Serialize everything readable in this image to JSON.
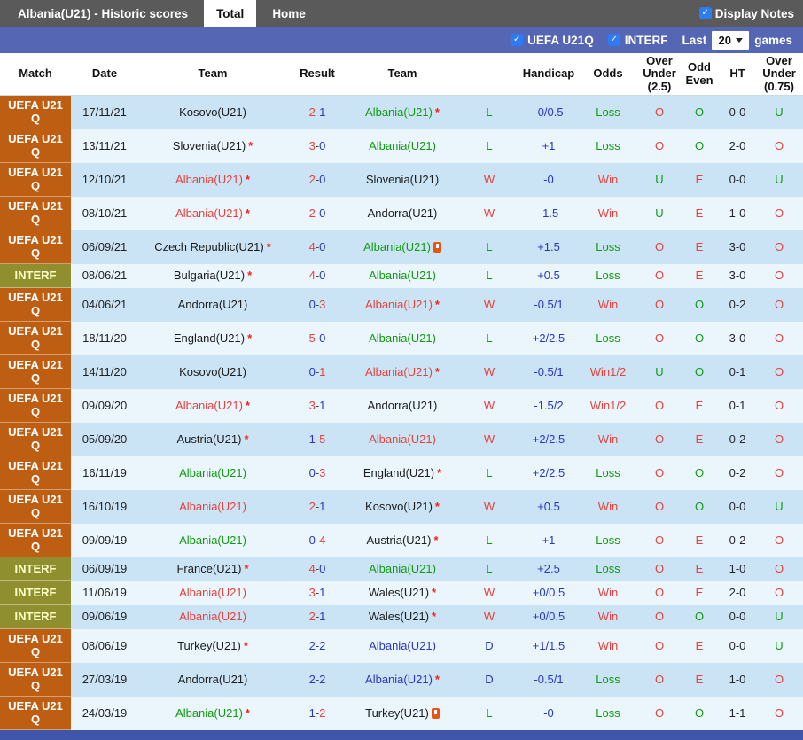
{
  "topbar": {
    "title": "Albania(U21) - Historic scores",
    "tabs": [
      {
        "label": "Total",
        "active": true
      },
      {
        "label": "Home",
        "active": false
      }
    ],
    "display_notes_label": "Display Notes",
    "display_notes_checked": true
  },
  "filterbar": {
    "checkboxes": [
      {
        "label": "UEFA U21Q",
        "checked": true
      },
      {
        "label": "INTERF",
        "checked": true
      }
    ],
    "last_label": "Last",
    "games_count": "20",
    "games_label": "games"
  },
  "colors": {
    "red": "#e8413d",
    "green": "#0f9b0f",
    "blue": "#2a36c4",
    "black": "#1c1c1c",
    "uefa_bg": "#bd5e13",
    "interf_bg": "#8f8f2f",
    "interf_text": "#ffffc8",
    "row_blue": "#cbe4f5",
    "row_light": "#eaf5fc",
    "topbar_bg": "#5a5a5a",
    "filterbar_bg": "#5466b4",
    "footer_bg": "#4056aa",
    "checkbox_blue": "#2e7bf6",
    "card_orange": "#e85512"
  },
  "table": {
    "headers": {
      "match": "Match",
      "date": "Date",
      "team1": "Team",
      "result": "Result",
      "team2": "Team",
      "hcp_result": "",
      "handicap": "Handicap",
      "odds": "Odds",
      "ou25": "Over Under (2.5)",
      "oddeven": "Odd Even",
      "ht": "HT",
      "ou075": "Over Under (0.75)"
    },
    "rows": [
      {
        "league": "UEFA U21 Q",
        "ltype": "uefa",
        "date": "17/11/21",
        "t1": "Kosovo(U21)",
        "t1c": "black",
        "t1s": false,
        "t1card": false,
        "s1": "2",
        "s1c": "red",
        "s2": "1",
        "s2c": "blue",
        "t2": "Albania(U21)",
        "t2c": "green",
        "t2s": true,
        "t2card": false,
        "hr": "L",
        "hrc": "green",
        "hcp": "-0/0.5",
        "odds": "Loss",
        "oddsc": "green",
        "ou": "O",
        "ouc": "red",
        "oe": "O",
        "oec": "green",
        "ht": "0-0",
        "ou2": "U",
        "ou2c": "green"
      },
      {
        "league": "UEFA U21 Q",
        "ltype": "uefa",
        "date": "13/11/21",
        "t1": "Slovenia(U21)",
        "t1c": "black",
        "t1s": true,
        "t1card": false,
        "s1": "3",
        "s1c": "red",
        "s2": "0",
        "s2c": "blue",
        "t2": "Albania(U21)",
        "t2c": "green",
        "t2s": false,
        "t2card": false,
        "hr": "L",
        "hrc": "green",
        "hcp": "+1",
        "odds": "Loss",
        "oddsc": "green",
        "ou": "O",
        "ouc": "red",
        "oe": "O",
        "oec": "green",
        "ht": "2-0",
        "ou2": "O",
        "ou2c": "red"
      },
      {
        "league": "UEFA U21 Q",
        "ltype": "uefa",
        "date": "12/10/21",
        "t1": "Albania(U21)",
        "t1c": "red",
        "t1s": true,
        "t1card": false,
        "s1": "2",
        "s1c": "red",
        "s2": "0",
        "s2c": "blue",
        "t2": "Slovenia(U21)",
        "t2c": "black",
        "t2s": false,
        "t2card": false,
        "hr": "W",
        "hrc": "red",
        "hcp": "-0",
        "odds": "Win",
        "oddsc": "red",
        "ou": "U",
        "ouc": "green",
        "oe": "E",
        "oec": "red",
        "ht": "0-0",
        "ou2": "U",
        "ou2c": "green"
      },
      {
        "league": "UEFA U21 Q",
        "ltype": "uefa",
        "date": "08/10/21",
        "t1": "Albania(U21)",
        "t1c": "red",
        "t1s": true,
        "t1card": false,
        "s1": "2",
        "s1c": "red",
        "s2": "0",
        "s2c": "blue",
        "t2": "Andorra(U21)",
        "t2c": "black",
        "t2s": false,
        "t2card": false,
        "hr": "W",
        "hrc": "red",
        "hcp": "-1.5",
        "odds": "Win",
        "oddsc": "red",
        "ou": "U",
        "ouc": "green",
        "oe": "E",
        "oec": "red",
        "ht": "1-0",
        "ou2": "O",
        "ou2c": "red"
      },
      {
        "league": "UEFA U21 Q",
        "ltype": "uefa",
        "date": "06/09/21",
        "t1": "Czech Republic(U21)",
        "t1c": "black",
        "t1s": true,
        "t1card": false,
        "s1": "4",
        "s1c": "red",
        "s2": "0",
        "s2c": "blue",
        "t2": "Albania(U21)",
        "t2c": "green",
        "t2s": false,
        "t2card": true,
        "hr": "L",
        "hrc": "green",
        "hcp": "+1.5",
        "odds": "Loss",
        "oddsc": "green",
        "ou": "O",
        "ouc": "red",
        "oe": "E",
        "oec": "red",
        "ht": "3-0",
        "ou2": "O",
        "ou2c": "red"
      },
      {
        "league": "INTERF",
        "ltype": "interf",
        "date": "08/06/21",
        "t1": "Bulgaria(U21)",
        "t1c": "black",
        "t1s": true,
        "t1card": false,
        "s1": "4",
        "s1c": "red",
        "s2": "0",
        "s2c": "blue",
        "t2": "Albania(U21)",
        "t2c": "green",
        "t2s": false,
        "t2card": false,
        "hr": "L",
        "hrc": "green",
        "hcp": "+0.5",
        "odds": "Loss",
        "oddsc": "green",
        "ou": "O",
        "ouc": "red",
        "oe": "E",
        "oec": "red",
        "ht": "3-0",
        "ou2": "O",
        "ou2c": "red"
      },
      {
        "league": "UEFA U21 Q",
        "ltype": "uefa",
        "date": "04/06/21",
        "t1": "Andorra(U21)",
        "t1c": "black",
        "t1s": false,
        "t1card": false,
        "s1": "0",
        "s1c": "blue",
        "s2": "3",
        "s2c": "red",
        "t2": "Albania(U21)",
        "t2c": "red",
        "t2s": true,
        "t2card": false,
        "hr": "W",
        "hrc": "red",
        "hcp": "-0.5/1",
        "odds": "Win",
        "oddsc": "red",
        "ou": "O",
        "ouc": "red",
        "oe": "O",
        "oec": "green",
        "ht": "0-2",
        "ou2": "O",
        "ou2c": "red"
      },
      {
        "league": "UEFA U21 Q",
        "ltype": "uefa",
        "date": "18/11/20",
        "t1": "England(U21)",
        "t1c": "black",
        "t1s": true,
        "t1card": false,
        "s1": "5",
        "s1c": "red",
        "s2": "0",
        "s2c": "blue",
        "t2": "Albania(U21)",
        "t2c": "green",
        "t2s": false,
        "t2card": false,
        "hr": "L",
        "hrc": "green",
        "hcp": "+2/2.5",
        "odds": "Loss",
        "oddsc": "green",
        "ou": "O",
        "ouc": "red",
        "oe": "O",
        "oec": "green",
        "ht": "3-0",
        "ou2": "O",
        "ou2c": "red"
      },
      {
        "league": "UEFA U21 Q",
        "ltype": "uefa",
        "date": "14/11/20",
        "t1": "Kosovo(U21)",
        "t1c": "black",
        "t1s": false,
        "t1card": false,
        "s1": "0",
        "s1c": "blue",
        "s2": "1",
        "s2c": "red",
        "t2": "Albania(U21)",
        "t2c": "red",
        "t2s": true,
        "t2card": false,
        "hr": "W",
        "hrc": "red",
        "hcp": "-0.5/1",
        "odds": "Win1/2",
        "oddsc": "red",
        "ou": "U",
        "ouc": "green",
        "oe": "O",
        "oec": "green",
        "ht": "0-1",
        "ou2": "O",
        "ou2c": "red"
      },
      {
        "league": "UEFA U21 Q",
        "ltype": "uefa",
        "date": "09/09/20",
        "t1": "Albania(U21)",
        "t1c": "red",
        "t1s": true,
        "t1card": false,
        "s1": "3",
        "s1c": "red",
        "s2": "1",
        "s2c": "blue",
        "t2": "Andorra(U21)",
        "t2c": "black",
        "t2s": false,
        "t2card": false,
        "hr": "W",
        "hrc": "red",
        "hcp": "-1.5/2",
        "odds": "Win1/2",
        "oddsc": "red",
        "ou": "O",
        "ouc": "red",
        "oe": "E",
        "oec": "red",
        "ht": "0-1",
        "ou2": "O",
        "ou2c": "red"
      },
      {
        "league": "UEFA U21 Q",
        "ltype": "uefa",
        "date": "05/09/20",
        "t1": "Austria(U21)",
        "t1c": "black",
        "t1s": true,
        "t1card": false,
        "s1": "1",
        "s1c": "blue",
        "s2": "5",
        "s2c": "red",
        "t2": "Albania(U21)",
        "t2c": "red",
        "t2s": false,
        "t2card": false,
        "hr": "W",
        "hrc": "red",
        "hcp": "+2/2.5",
        "odds": "Win",
        "oddsc": "red",
        "ou": "O",
        "ouc": "red",
        "oe": "E",
        "oec": "red",
        "ht": "0-2",
        "ou2": "O",
        "ou2c": "red"
      },
      {
        "league": "UEFA U21 Q",
        "ltype": "uefa",
        "date": "16/11/19",
        "t1": "Albania(U21)",
        "t1c": "green",
        "t1s": false,
        "t1card": false,
        "s1": "0",
        "s1c": "blue",
        "s2": "3",
        "s2c": "red",
        "t2": "England(U21)",
        "t2c": "black",
        "t2s": true,
        "t2card": false,
        "hr": "L",
        "hrc": "green",
        "hcp": "+2/2.5",
        "odds": "Loss",
        "oddsc": "green",
        "ou": "O",
        "ouc": "red",
        "oe": "O",
        "oec": "green",
        "ht": "0-2",
        "ou2": "O",
        "ou2c": "red"
      },
      {
        "league": "UEFA U21 Q",
        "ltype": "uefa",
        "date": "16/10/19",
        "t1": "Albania(U21)",
        "t1c": "red",
        "t1s": false,
        "t1card": false,
        "s1": "2",
        "s1c": "red",
        "s2": "1",
        "s2c": "blue",
        "t2": "Kosovo(U21)",
        "t2c": "black",
        "t2s": true,
        "t2card": false,
        "hr": "W",
        "hrc": "red",
        "hcp": "+0.5",
        "odds": "Win",
        "oddsc": "red",
        "ou": "O",
        "ouc": "red",
        "oe": "O",
        "oec": "green",
        "ht": "0-0",
        "ou2": "U",
        "ou2c": "green"
      },
      {
        "league": "UEFA U21 Q",
        "ltype": "uefa",
        "date": "09/09/19",
        "t1": "Albania(U21)",
        "t1c": "green",
        "t1s": false,
        "t1card": false,
        "s1": "0",
        "s1c": "blue",
        "s2": "4",
        "s2c": "red",
        "t2": "Austria(U21)",
        "t2c": "black",
        "t2s": true,
        "t2card": false,
        "hr": "L",
        "hrc": "green",
        "hcp": "+1",
        "odds": "Loss",
        "oddsc": "green",
        "ou": "O",
        "ouc": "red",
        "oe": "E",
        "oec": "red",
        "ht": "0-2",
        "ou2": "O",
        "ou2c": "red"
      },
      {
        "league": "INTERF",
        "ltype": "interf",
        "date": "06/09/19",
        "t1": "France(U21)",
        "t1c": "black",
        "t1s": true,
        "t1card": false,
        "s1": "4",
        "s1c": "red",
        "s2": "0",
        "s2c": "blue",
        "t2": "Albania(U21)",
        "t2c": "green",
        "t2s": false,
        "t2card": false,
        "hr": "L",
        "hrc": "green",
        "hcp": "+2.5",
        "odds": "Loss",
        "oddsc": "green",
        "ou": "O",
        "ouc": "red",
        "oe": "E",
        "oec": "red",
        "ht": "1-0",
        "ou2": "O",
        "ou2c": "red"
      },
      {
        "league": "INTERF",
        "ltype": "interf",
        "date": "11/06/19",
        "t1": "Albania(U21)",
        "t1c": "red",
        "t1s": false,
        "t1card": false,
        "s1": "3",
        "s1c": "red",
        "s2": "1",
        "s2c": "blue",
        "t2": "Wales(U21)",
        "t2c": "black",
        "t2s": true,
        "t2card": false,
        "hr": "W",
        "hrc": "red",
        "hcp": "+0/0.5",
        "odds": "Win",
        "oddsc": "red",
        "ou": "O",
        "ouc": "red",
        "oe": "E",
        "oec": "red",
        "ht": "2-0",
        "ou2": "O",
        "ou2c": "red"
      },
      {
        "league": "INTERF",
        "ltype": "interf",
        "date": "09/06/19",
        "t1": "Albania(U21)",
        "t1c": "red",
        "t1s": false,
        "t1card": false,
        "s1": "2",
        "s1c": "red",
        "s2": "1",
        "s2c": "blue",
        "t2": "Wales(U21)",
        "t2c": "black",
        "t2s": true,
        "t2card": false,
        "hr": "W",
        "hrc": "red",
        "hcp": "+0/0.5",
        "odds": "Win",
        "oddsc": "red",
        "ou": "O",
        "ouc": "red",
        "oe": "O",
        "oec": "green",
        "ht": "0-0",
        "ou2": "U",
        "ou2c": "green"
      },
      {
        "league": "UEFA U21 Q",
        "ltype": "uefa",
        "date": "08/06/19",
        "t1": "Turkey(U21)",
        "t1c": "black",
        "t1s": true,
        "t1card": false,
        "s1": "2",
        "s1c": "blue",
        "s2": "2",
        "s2c": "blue",
        "t2": "Albania(U21)",
        "t2c": "blue",
        "t2s": false,
        "t2card": false,
        "hr": "D",
        "hrc": "blue",
        "hcp": "+1/1.5",
        "odds": "Win",
        "oddsc": "red",
        "ou": "O",
        "ouc": "red",
        "oe": "E",
        "oec": "red",
        "ht": "0-0",
        "ou2": "U",
        "ou2c": "green"
      },
      {
        "league": "UEFA U21 Q",
        "ltype": "uefa",
        "date": "27/03/19",
        "t1": "Andorra(U21)",
        "t1c": "black",
        "t1s": false,
        "t1card": false,
        "s1": "2",
        "s1c": "blue",
        "s2": "2",
        "s2c": "blue",
        "t2": "Albania(U21)",
        "t2c": "blue",
        "t2s": true,
        "t2card": false,
        "hr": "D",
        "hrc": "blue",
        "hcp": "-0.5/1",
        "odds": "Loss",
        "oddsc": "green",
        "ou": "O",
        "ouc": "red",
        "oe": "E",
        "oec": "red",
        "ht": "1-0",
        "ou2": "O",
        "ou2c": "red"
      },
      {
        "league": "UEFA U21 Q",
        "ltype": "uefa",
        "date": "24/03/19",
        "t1": "Albania(U21)",
        "t1c": "green",
        "t1s": true,
        "t1card": false,
        "s1": "1",
        "s1c": "blue",
        "s2": "2",
        "s2c": "red",
        "t2": "Turkey(U21)",
        "t2c": "black",
        "t2s": false,
        "t2card": true,
        "hr": "L",
        "hrc": "green",
        "hcp": "-0",
        "odds": "Loss",
        "oddsc": "green",
        "ou": "O",
        "ouc": "red",
        "oe": "O",
        "oec": "green",
        "ht": "1-1",
        "ou2": "O",
        "ou2c": "red"
      }
    ]
  }
}
